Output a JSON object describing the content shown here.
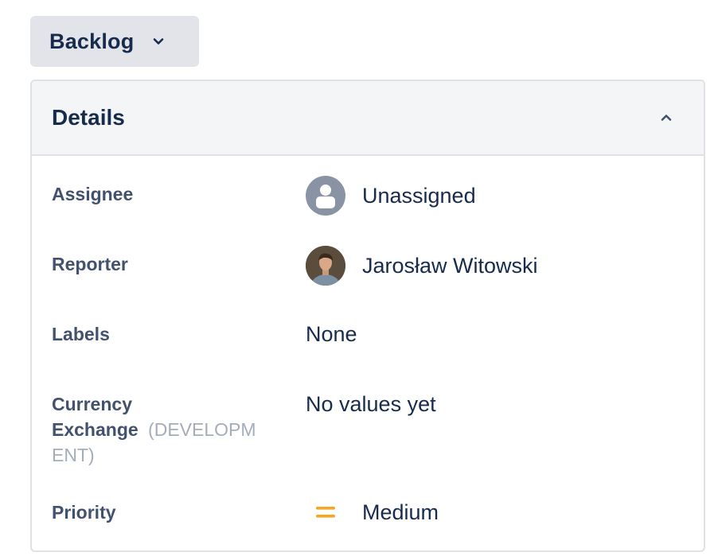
{
  "status_button": {
    "label": "Backlog",
    "icon": "chevron-down-icon"
  },
  "details": {
    "title": "Details",
    "collapse_icon": "chevron-up-icon",
    "fields": {
      "assignee": {
        "label": "Assignee",
        "value": "Unassigned",
        "icon": "user-placeholder-icon"
      },
      "reporter": {
        "label": "Reporter",
        "value": "Jarosław Witowski",
        "icon": "avatar"
      },
      "labels": {
        "label": "Labels",
        "value": "None"
      },
      "currency_exchange": {
        "label_line1": "Currency",
        "label_line2": "Exchange",
        "hint_part1": "(DEVELOPM",
        "hint_part2": "ENT)",
        "value": "No values yet"
      },
      "priority": {
        "label": "Priority",
        "value": "Medium",
        "icon": "priority-medium-icon",
        "icon_color": "#f5a623"
      }
    }
  },
  "colors": {
    "text_primary": "#172b4d",
    "text_label": "#42526e",
    "text_hint": "#a5adba",
    "button_bg": "#e2e4e9",
    "header_bg": "#f4f5f7",
    "border": "#dfe1e6"
  }
}
